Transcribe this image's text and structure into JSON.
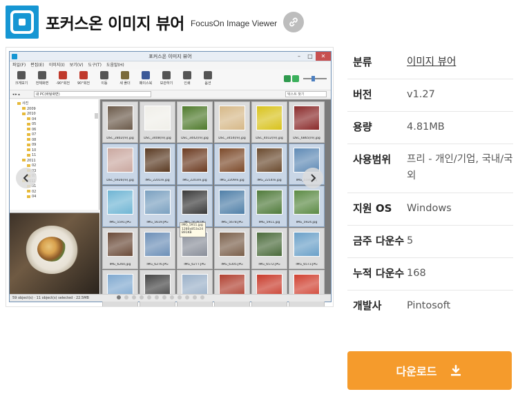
{
  "header": {
    "title": "포커스온 이미지 뷰어",
    "subtitle": "FocusOn Image Viewer"
  },
  "screenshot": {
    "window_title": "포커스온 이미지 뷰어",
    "menu": [
      "파일(F)",
      "편집(E)",
      "이미지(I)",
      "보기(V)",
      "도구(T)",
      "도움말(H)"
    ],
    "toolbar": [
      "크게보기",
      "전체화면",
      "-90°회전",
      "90°회전",
      "이동",
      "새 폴더",
      "페이스북",
      "보관하기",
      "인쇄",
      "옵션"
    ],
    "address": "내 PC(바탕화면)",
    "search_placeholder": "텍스트 찾기",
    "tree": [
      {
        "label": "사진",
        "indent": 1
      },
      {
        "label": "2009",
        "indent": 2
      },
      {
        "label": "2010",
        "indent": 2
      },
      {
        "label": "04",
        "indent": 3
      },
      {
        "label": "05",
        "indent": 3
      },
      {
        "label": "06",
        "indent": 3
      },
      {
        "label": "07",
        "indent": 3
      },
      {
        "label": "08",
        "indent": 3
      },
      {
        "label": "09",
        "indent": 3
      },
      {
        "label": "10",
        "indent": 3
      },
      {
        "label": "11",
        "indent": 3
      },
      {
        "label": "2011",
        "indent": 2
      },
      {
        "label": "02",
        "indent": 3
      },
      {
        "label": "03",
        "indent": 3
      },
      {
        "label": "07",
        "indent": 3
      },
      {
        "label": "2012",
        "indent": 2
      },
      {
        "label": "01",
        "indent": 3
      },
      {
        "label": "02",
        "indent": 3
      },
      {
        "label": "04",
        "indent": 3
      }
    ],
    "thumbnails": [
      {
        "caption": "DSC_2802(re).jpg",
        "color": "#6b5a4a",
        "sel": false
      },
      {
        "caption": "DSC_3408(re).jpg",
        "color": "#f0efe9",
        "sel": false
      },
      {
        "caption": "DSC_3442(re).jpg",
        "color": "#4f7a2c",
        "sel": false
      },
      {
        "caption": "DSC_3454(re).jpg",
        "color": "#d6b888",
        "sel": false
      },
      {
        "caption": "DSC_4012(re).jpg",
        "color": "#d8c21c",
        "sel": false
      },
      {
        "caption": "DSC_6865(re).jpg",
        "color": "#8a2a2a",
        "sel": false
      },
      {
        "caption": "DSC_6926(re).jpg",
        "color": "#caa8a0",
        "sel": true
      },
      {
        "caption": "IMG_2201re.jpg",
        "color": "#5a3a22",
        "sel": true
      },
      {
        "caption": "IMG_2203re.jpg",
        "color": "#6b3a20",
        "sel": true
      },
      {
        "caption": "IMG_2209re.jpg",
        "color": "#7c4a2a",
        "sel": true
      },
      {
        "caption": "IMG_2214re.jpg",
        "color": "#6a4a2e",
        "sel": true
      },
      {
        "caption": "IMG_5588.jpg",
        "color": "#5f8ab5",
        "sel": true
      },
      {
        "caption": "IMG_5591.JPG",
        "color": "#6fb5d4",
        "sel": true
      },
      {
        "caption": "IMG_5619.JPG",
        "color": "#7aa0c0",
        "sel": true
      },
      {
        "caption": "IMG_5638.JPG",
        "color": "#3a3a3a",
        "sel": true
      },
      {
        "caption": "IMG_5678.JPG",
        "color": "#4f7fa8",
        "sel": true
      },
      {
        "caption": "IMG_5911.jpg",
        "color": "#4f7a3a",
        "sel": true
      },
      {
        "caption": "IMG_5924.jpg",
        "color": "#5b8a44",
        "sel": true
      },
      {
        "caption": "IMG_6260.jpg",
        "color": "#6a4a38",
        "sel": false
      },
      {
        "caption": "IMG_6276.JPG",
        "color": "#6c8fb7",
        "sel": false
      },
      {
        "caption": "IMG_6277.JPG",
        "color": "#8a8f9a",
        "sel": false
      },
      {
        "caption": "IMG_6305.JPG",
        "color": "#7a5f4a",
        "sel": false
      },
      {
        "caption": "IMG_6572.JPG",
        "color": "#4a6a3a",
        "sel": false
      },
      {
        "caption": "IMG_6573.JPG",
        "color": "#6aa0c8",
        "sel": false
      },
      {
        "caption": "",
        "color": "#7fa8cf",
        "sel": false
      },
      {
        "caption": "",
        "color": "#444444",
        "sel": false
      },
      {
        "caption": "",
        "color": "#9ab0c8",
        "sel": false
      },
      {
        "caption": "",
        "color": "#b04030",
        "sel": false
      },
      {
        "caption": "",
        "color": "#c83a2a",
        "sel": false
      },
      {
        "caption": "",
        "color": "#d04030",
        "sel": false
      }
    ],
    "tooltip": [
      "IMG_5911.jpg",
      "1280x853x24",
      "891KB"
    ],
    "status": "59 object(s) · 11 object(s) selected · 22.5MB",
    "dots": 12,
    "active_dot": 0
  },
  "info": [
    {
      "key": "분류",
      "value": "이미지 뷰어",
      "link": true
    },
    {
      "key": "버전",
      "value": "v1.27",
      "link": false
    },
    {
      "key": "용량",
      "value": "4.81MB",
      "link": false
    },
    {
      "key": "사용범위",
      "value": "프리 - 개인/기업, 국내/국외",
      "link": false
    },
    {
      "key": "지원 OS",
      "value": "Windows",
      "link": false
    },
    {
      "key": "금주 다운수",
      "value": "5",
      "link": false
    },
    {
      "key": "누적 다운수",
      "value": "168",
      "link": false
    },
    {
      "key": "개발사",
      "value": "Pintosoft",
      "link": false
    }
  ],
  "download_label": "다운로드",
  "colors": {
    "brand": "#1696d3",
    "download": "#f59b2c"
  }
}
